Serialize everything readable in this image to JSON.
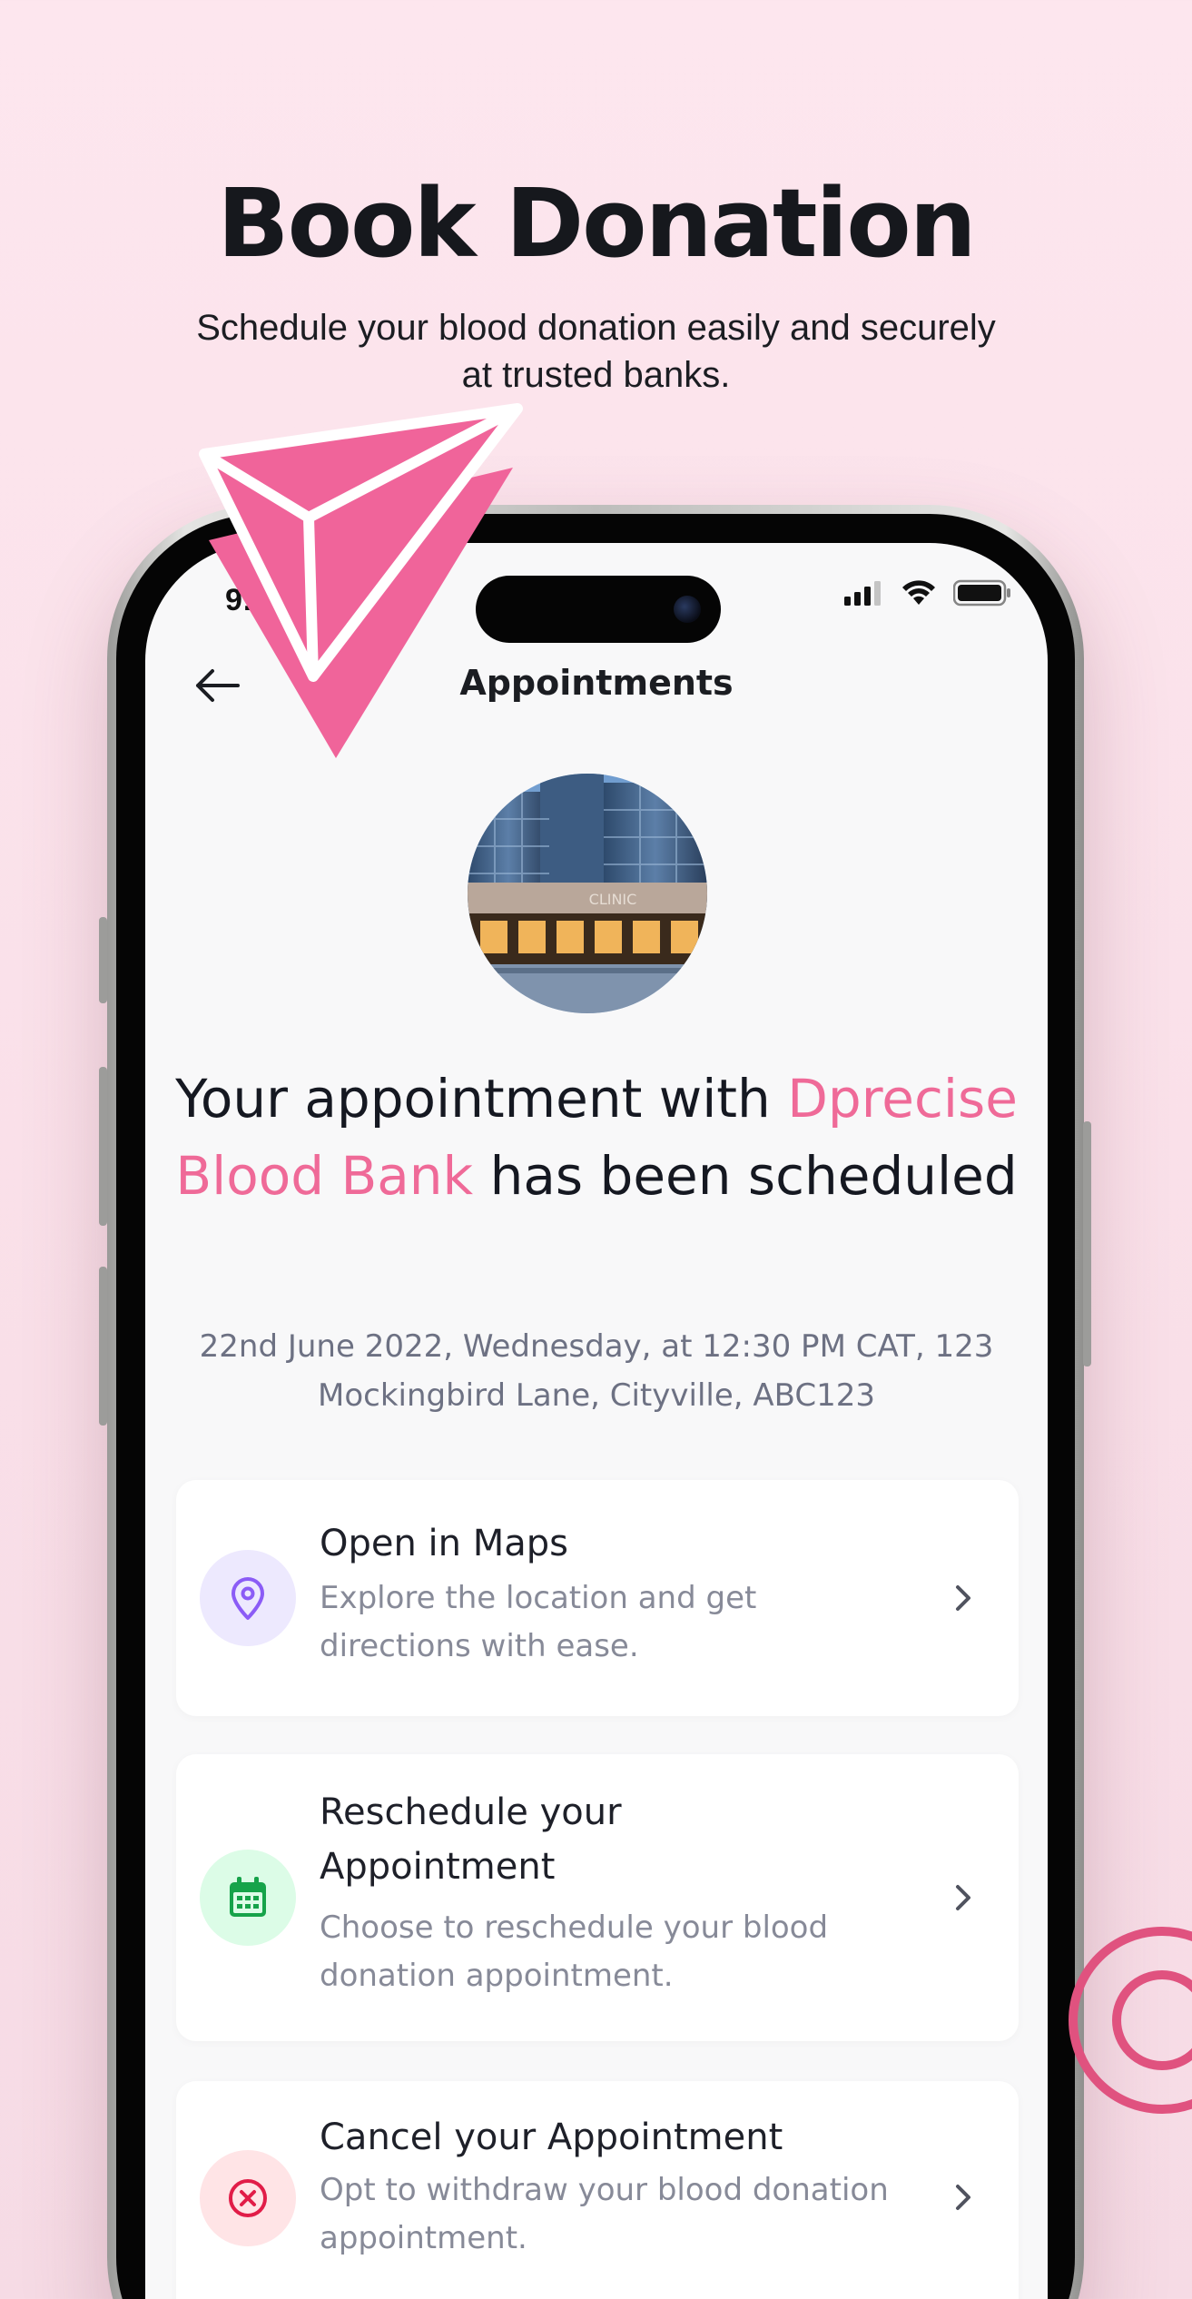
{
  "promo": {
    "headline": "Book Donation",
    "subline": "Schedule your blood donation easily and securely at trusted banks."
  },
  "status_bar": {
    "time": "9:41",
    "icons": [
      "cellular-signal-icon",
      "wifi-icon",
      "battery-icon"
    ]
  },
  "nav": {
    "back_icon": "arrow-left-icon",
    "title": "Appointments"
  },
  "confirmation": {
    "image_alt": "clinic-building-photo",
    "text_before": "Your appointment with",
    "bank_name": "Dprecise Blood Bank",
    "text_after": "has been scheduled",
    "details": "22nd June 2022, Wednesday, at 12:30 PM CAT, 123 Mockingbird Lane, Cityville, ABC123",
    "image_sign_text": "CLINIC"
  },
  "actions": [
    {
      "title": "Open in Maps",
      "description": "Explore the location and get directions with ease.",
      "icon": "map-pin-icon",
      "icon_bg": "#ede9fe",
      "icon_color": "#8b5cf6"
    },
    {
      "title": "Reschedule your Appointment",
      "description": "Choose to reschedule your blood donation appointment.",
      "icon": "calendar-icon",
      "icon_bg": "#dcfce7",
      "icon_color": "#16a34a"
    },
    {
      "title": "Cancel your Appointment",
      "description": "Opt to withdraw your blood donation appointment.",
      "icon": "cancel-circle-icon",
      "icon_bg": "#ffe4e6",
      "icon_color": "#e11d48"
    }
  ],
  "colors": {
    "accent_pink": "#ef6a98",
    "background": "#fde6ee",
    "deco_pink": "#f0649a"
  }
}
